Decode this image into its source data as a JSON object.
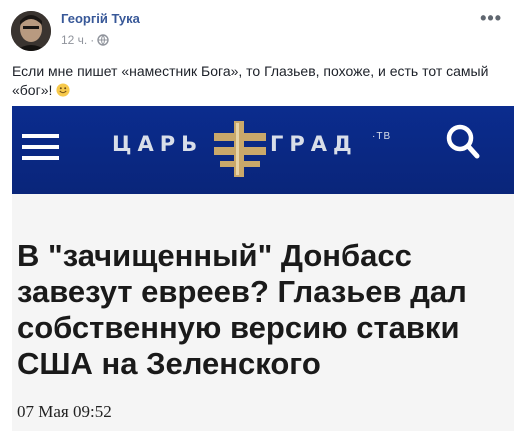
{
  "post": {
    "author": "Георгій Тука",
    "time": "12 ч.",
    "privacy_icon": "globe-icon",
    "more_icon": "more-horizontal-icon",
    "text": "Если мне пишет «наместник Бога», то Глазьев, похоже, и есть тот самый «бог»!",
    "emoji": "smiley-emoji"
  },
  "shared_image": {
    "site": {
      "logo_left": "ЦАРЬ",
      "logo_right": "ГРАД",
      "logo_suffix": "·ТВ",
      "menu_icon": "hamburger-menu-icon",
      "search_icon": "search-icon",
      "bar_color": "#0b2c8e",
      "cross_color": "#c9a86a"
    },
    "headline": "В \"зачищенный\" Донбасс завезут евреев? Глазьев дал собственную версию ставки США на Зеленского",
    "date": "07 Мая 09:52"
  }
}
